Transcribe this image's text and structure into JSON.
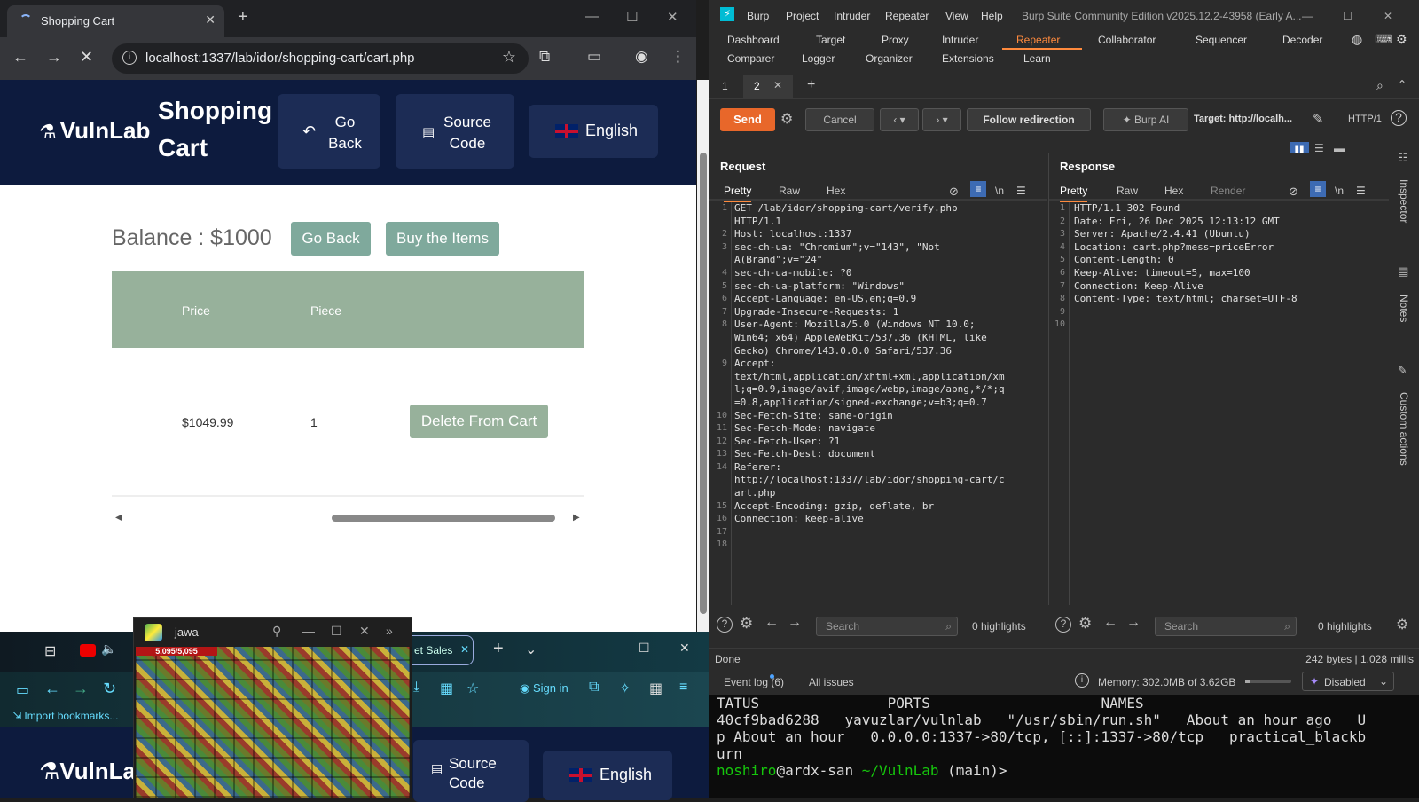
{
  "browser": {
    "tab_title": "Shopping Cart",
    "url": "localhost:1337/lab/idor/shopping-cart/cart.php"
  },
  "vulnlab": {
    "logo": "VulnLab",
    "title": "Shopping Cart",
    "go_back": "Go Back",
    "source_code": "Source Code",
    "language": "English",
    "balance": "Balance : $1000",
    "btn_go_back": "Go Back",
    "btn_buy": "Buy the Items",
    "table_headers": [
      "Price",
      "Piece"
    ],
    "row_price": "$1049.99",
    "row_piece": "1",
    "btn_delete": "Delete From Cart"
  },
  "burp": {
    "menu": [
      "Burp",
      "Project",
      "Intruder",
      "Repeater",
      "View",
      "Help"
    ],
    "window_title": "Burp Suite Community Edition v2025.12.2-43958 (Early A...",
    "main_tabs_row1": [
      "Dashboard",
      "Target",
      "Proxy",
      "Intruder",
      "Repeater",
      "Collaborator",
      "Sequencer",
      "Decoder"
    ],
    "main_tabs_row2": [
      "Comparer",
      "Logger",
      "Organizer",
      "Extensions",
      "Learn"
    ],
    "repeater_tabs": [
      "1",
      "2"
    ],
    "send": "Send",
    "cancel": "Cancel",
    "follow": "Follow redirection",
    "burp_ai": "Burp AI",
    "target": "Target: http://localh...",
    "http_version": "HTTP/1",
    "request_title": "Request",
    "response_title": "Response",
    "req_tabs": [
      "Pretty",
      "Raw",
      "Hex"
    ],
    "resp_tabs": [
      "Pretty",
      "Raw",
      "Hex",
      "Render"
    ],
    "request_lines": [
      "GET /lab/idor/shopping-cart/verify.php",
      "HTTP/1.1",
      "Host: localhost:1337",
      "sec-ch-ua: \"Chromium\";v=\"143\", \"Not",
      "A(Brand\";v=\"24\"",
      "sec-ch-ua-mobile: ?0",
      "sec-ch-ua-platform: \"Windows\"",
      "Accept-Language: en-US,en;q=0.9",
      "Upgrade-Insecure-Requests: 1",
      "User-Agent: Mozilla/5.0 (Windows NT 10.0;",
      "Win64; x64) AppleWebKit/537.36 (KHTML, like",
      "Gecko) Chrome/143.0.0.0 Safari/537.36",
      "Accept:",
      "text/html,application/xhtml+xml,application/xm",
      "l;q=0.9,image/avif,image/webp,image/apng,*/*;q",
      "=0.8,application/signed-exchange;v=b3;q=0.7",
      "Sec-Fetch-Site: same-origin",
      "Sec-Fetch-Mode: navigate",
      "Sec-Fetch-User: ?1",
      "Sec-Fetch-Dest: document",
      "Referer:",
      "http://localhost:1337/lab/idor/shopping-cart/c",
      "art.php",
      "Accept-Encoding: gzip, deflate, br",
      "Connection: keep-alive",
      "",
      ""
    ],
    "request_linenos": [
      "1",
      "",
      "2",
      "3",
      "",
      "4",
      "5",
      "6",
      "7",
      "8",
      "",
      "",
      "9",
      "",
      "",
      "",
      "10",
      "11",
      "12",
      "13",
      "14",
      "",
      "",
      "15",
      "16",
      "17",
      "18"
    ],
    "response_lines": [
      "HTTP/1.1 302 Found",
      "Date: Fri, 26 Dec 2025 12:13:12 GMT",
      "Server: Apache/2.4.41 (Ubuntu)",
      "Location: cart.php?mess=priceError",
      "Content-Length: 0",
      "Keep-Alive: timeout=5, max=100",
      "Connection: Keep-Alive",
      "Content-Type: text/html; charset=UTF-8",
      "",
      ""
    ],
    "response_linenos": [
      "1",
      "2",
      "3",
      "4",
      "5",
      "6",
      "7",
      "8",
      "9",
      "10"
    ],
    "search_placeholder": "Search",
    "highlights": "0 highlights",
    "status_left": "Done",
    "status_right": "242 bytes | 1,028 millis",
    "event_log": "Event log (6)",
    "all_issues": "All issues",
    "memory": "Memory: 302.0MB of 3.62GB",
    "disabled": "Disabled",
    "side_labels": [
      "Inspector",
      "Notes",
      "Custom actions"
    ]
  },
  "terminal": {
    "lines": [
      "TATUS               PORTS                    NAMES",
      "40cf9bad6288   yavuzlar/vulnlab   \"/usr/sbin/run.sh\"   About an hour ago   U",
      "p About an hour   0.0.0.0:1337->80/tcp, [::]:1337->80/tcp   practical_blackb",
      "urn"
    ],
    "prompt_user": "noshiro",
    "prompt_host": "@ardx-san",
    "prompt_path": " ~/VulnLab",
    "prompt_branch": " (main)>"
  },
  "bottom": {
    "tab_label": "et Sales",
    "sign_in": "Sign in",
    "import_bookmarks": "Import bookmarks...",
    "logo_partial": "VulnLa",
    "source_code": "Source Code",
    "language": "English",
    "jawa_title": "jawa",
    "hp_text": "5,095/5,095"
  }
}
